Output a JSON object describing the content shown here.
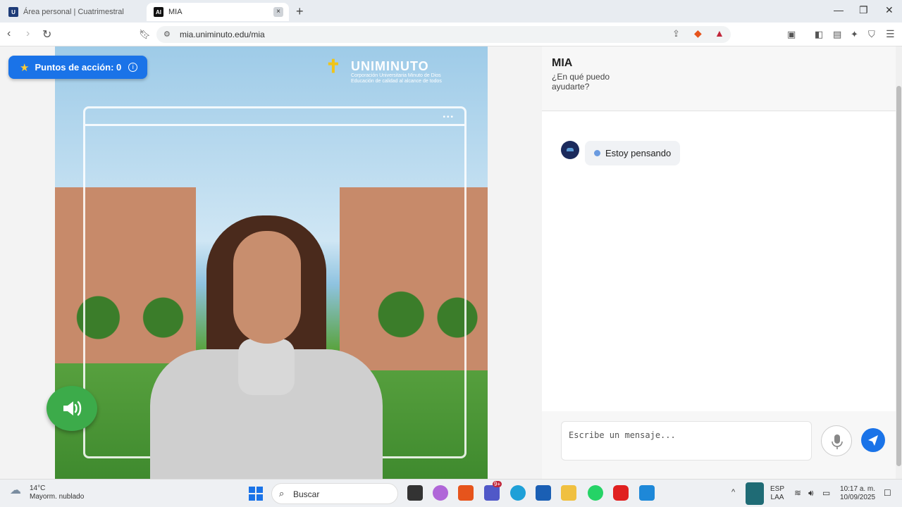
{
  "browser": {
    "tabs": [
      {
        "label": "Área personal | Cuatrimestral",
        "favicon": "uniminuto-favicon"
      },
      {
        "label": "MIA",
        "favicon": "ai-favicon",
        "active": true
      }
    ],
    "new_tab": "+",
    "url": "mia.uniminuto.edu/mia",
    "window_controls": [
      "minimize-icon",
      "maximize-icon",
      "close-icon"
    ]
  },
  "avatar_panel": {
    "points_label": "Puntos de acción: 0",
    "logo_name": "UNIMINUTO",
    "logo_subtitle_1": "Corporación Universitaria Minuto de Dios",
    "logo_subtitle_2": "Educación de calidad al alcance de todos",
    "frame_dots": "•••"
  },
  "chat": {
    "title": "MIA",
    "subtitle": "¿En qué puedo ayudarte?",
    "thinking_message": "Estoy pensando",
    "input_placeholder": "Escribe un mensaje..."
  },
  "taskbar": {
    "weather_temp": "14°C",
    "weather_desc": "Mayorm. nublado",
    "search_label": "Buscar",
    "lang_1": "ESP",
    "lang_2": "LAA",
    "time": "10:17 a. m.",
    "date": "10/09/2025",
    "teams_badge": "9+"
  },
  "colors": {
    "accent": "#1a73e8",
    "sound_button": "#3cab4a",
    "thinking_dot": "#6a9be0"
  }
}
